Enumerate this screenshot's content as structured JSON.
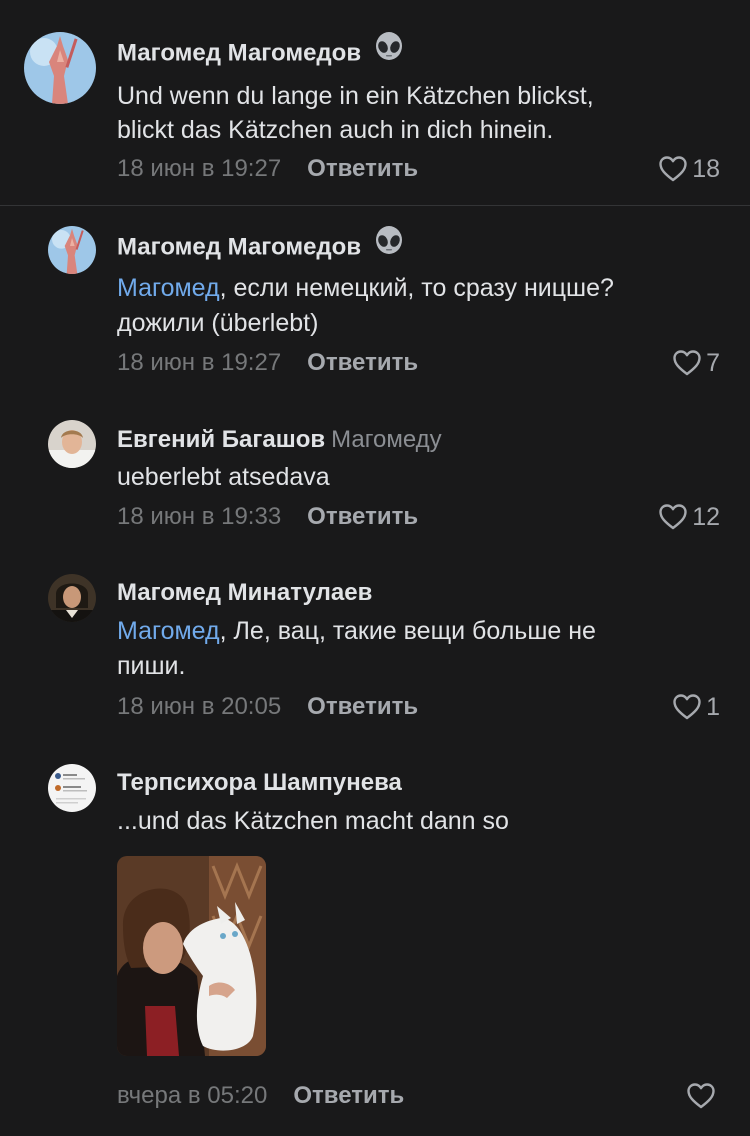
{
  "comments": [
    {
      "author": "Магомед Магомедов",
      "author_emoji": "alien-icon",
      "lines": [
        "Und wenn du lange in ein Kätzchen blickst,",
        "blickt das Kätzchen auch in dich hinein."
      ],
      "date": "18 июн в 19:27",
      "reply_label": "Ответить",
      "likes": "18"
    },
    {
      "author": "Магомед Магомедов",
      "author_emoji": "alien-icon",
      "mention": "Магомед",
      "lines": [
        ", если немецкий, то сразу ницше?",
        "дожили (überlebt)"
      ],
      "date": "18 июн в 19:27",
      "reply_label": "Ответить",
      "likes": "7"
    },
    {
      "author": "Евгений Багашов",
      "reply_to": "Магомеду",
      "lines": [
        "ueberlebt atsedava"
      ],
      "date": "18 июн в 19:33",
      "reply_label": "Ответить",
      "likes": "12"
    },
    {
      "author": "Магомед Минатулаев",
      "mention": "Магомед",
      "lines": [
        ", Ле, вац, такие вещи больше не",
        "пиши."
      ],
      "date": "18 июн в 20:05",
      "reply_label": "Ответить",
      "likes": "1"
    },
    {
      "author": "Терпсихора Шампунева",
      "lines": [
        "...und das Kätzchen macht dann so"
      ],
      "attachment": "photo-woman-with-white-cat",
      "date": "вчера в 05:20",
      "reply_label": "Ответить",
      "likes": ""
    }
  ],
  "colors": {
    "background": "#19191a",
    "text": "#e1e3e6",
    "mention": "#71aaeb",
    "secondary": "#76787a",
    "action": "#a6a9ae"
  }
}
